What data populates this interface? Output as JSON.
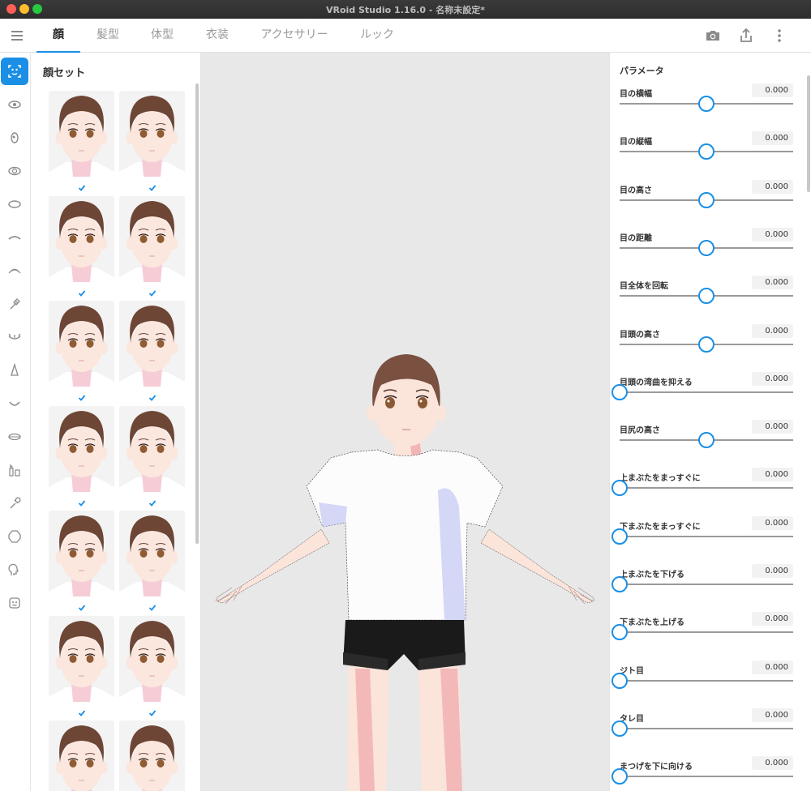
{
  "window": {
    "title": "VRoid Studio 1.16.0 - 名称未設定*"
  },
  "tabs": [
    {
      "label": "顔"
    },
    {
      "label": "髪型"
    },
    {
      "label": "体型"
    },
    {
      "label": "衣装"
    },
    {
      "label": "アクセサリー"
    },
    {
      "label": "ルック"
    }
  ],
  "toolbar": {
    "icons": [
      "camera-icon",
      "share-icon",
      "more-icon"
    ]
  },
  "rail": {
    "items": [
      "face-set",
      "eye",
      "iris",
      "eye-highlight",
      "eye-white",
      "eyebrow",
      "eyelash",
      "eyeline",
      "eye-shadow",
      "nose",
      "mouth",
      "teeth",
      "tongue",
      "cheek",
      "outline",
      "ear",
      "face-other"
    ],
    "active": "face-set"
  },
  "presets": {
    "title": "顔セット",
    "count": 14
  },
  "params": {
    "title": "パラメータ",
    "items": [
      {
        "label": "目の横幅",
        "value": "0.000",
        "slider": 0.5
      },
      {
        "label": "目の縦幅",
        "value": "0.000",
        "slider": 0.5
      },
      {
        "label": "目の高さ",
        "value": "0.000",
        "slider": 0.5
      },
      {
        "label": "目の距離",
        "value": "0.000",
        "slider": 0.5
      },
      {
        "label": "目全体を回転",
        "value": "0.000",
        "slider": 0.5
      },
      {
        "label": "目頭の高さ",
        "value": "0.000",
        "slider": 0.5
      },
      {
        "label": "目頭の湾曲を抑える",
        "value": "0.000",
        "slider": 0
      },
      {
        "label": "目尻の高さ",
        "value": "0.000",
        "slider": 0.5
      },
      {
        "label": "上まぶたをまっすぐに",
        "value": "0.000",
        "slider": 0
      },
      {
        "label": "下まぶたをまっすぐに",
        "value": "0.000",
        "slider": 0
      },
      {
        "label": "上まぶたを下げる",
        "value": "0.000",
        "slider": 0
      },
      {
        "label": "下まぶたを上げる",
        "value": "0.000",
        "slider": 0
      },
      {
        "label": "ジト目",
        "value": "0.000",
        "slider": 0
      },
      {
        "label": "タレ目",
        "value": "0.000",
        "slider": 0
      },
      {
        "label": "まつげを下に向ける",
        "value": "0.000",
        "slider": 0
      }
    ]
  },
  "colors": {
    "accent": "#1b8fe6",
    "viewport": "#e8e8e8"
  }
}
